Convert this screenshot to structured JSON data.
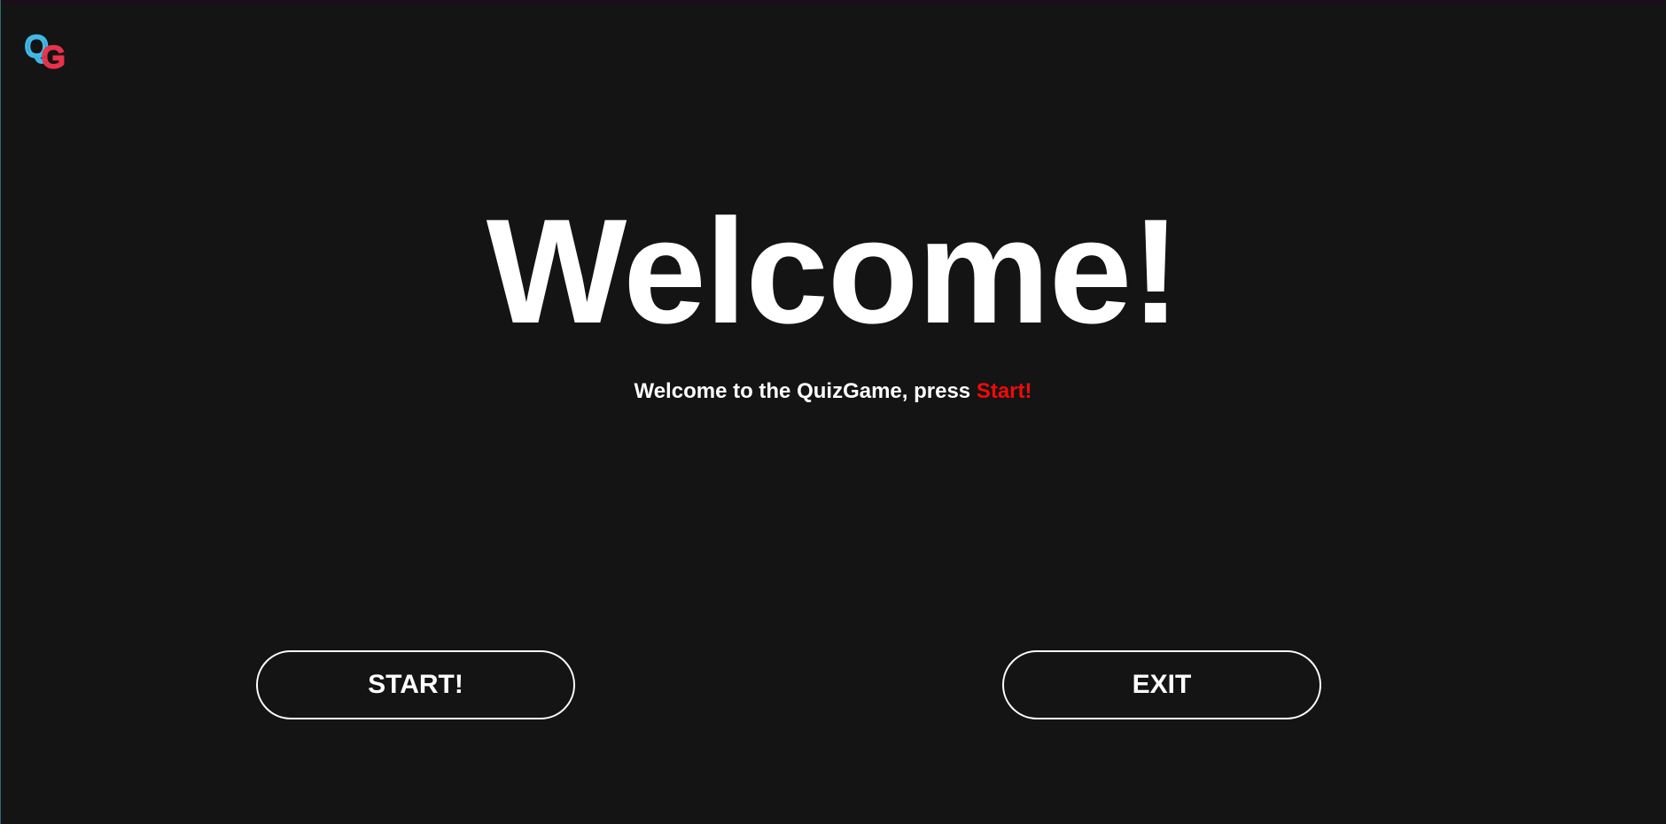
{
  "logo": {
    "letter1": "Q",
    "letter2": "G",
    "color1": "#41b8e6",
    "color2": "#e8324a"
  },
  "main": {
    "title": "Welcome!",
    "subtitle_text": "Welcome to the QuizGame, press ",
    "subtitle_accent": "Start!",
    "accent_color": "#f00a0a"
  },
  "buttons": {
    "start_label": "START!",
    "exit_label": "EXIT"
  },
  "theme": {
    "background": "#141414",
    "foreground": "#ffffff"
  }
}
